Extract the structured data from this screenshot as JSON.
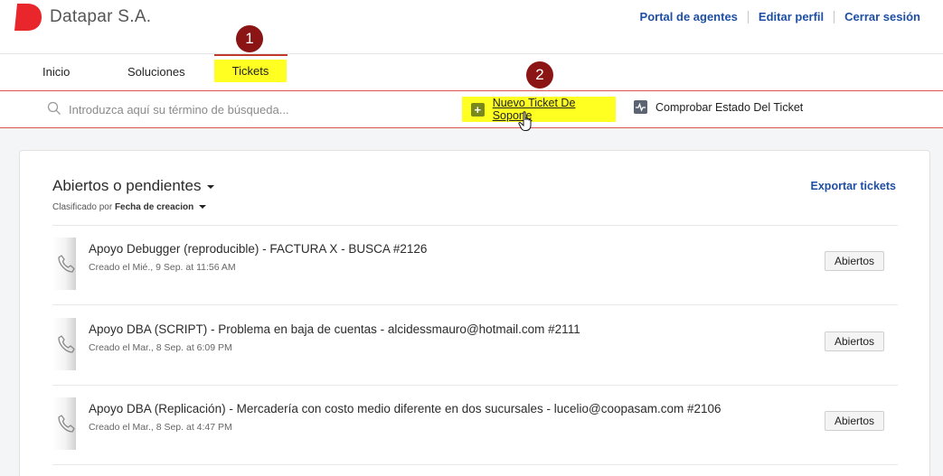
{
  "header": {
    "brand": "Datapar S.A.",
    "links": [
      "Portal de agentes",
      "Editar perfil",
      "Cerrar sesión"
    ],
    "accent_color": "#e8262b"
  },
  "nav": {
    "items": [
      "Inicio",
      "Soluciones",
      "Tickets"
    ],
    "active": "Tickets"
  },
  "annotations": [
    "1",
    "2"
  ],
  "search": {
    "placeholder": "Introduzca aquí su término de búsqueda..."
  },
  "actions": {
    "new_ticket": "Nuevo Ticket De Soporte",
    "check_status": "Comprobar Estado Del Ticket"
  },
  "tickets_view": {
    "title": "Abiertos o pendientes",
    "sort_prefix": "Clasificado por",
    "sort_field": "Fecha de creacion",
    "export": "Exportar tickets",
    "tickets": [
      {
        "title": "Apoyo Debugger (reproducible) - FACTURA X - BUSCA #2126",
        "date": "Creado el Mié., 9 Sep. at 11:56 AM",
        "status": "Abiertos"
      },
      {
        "title": "Apoyo DBA (SCRIPT) - Problema en baja de cuentas - alcidessmauro@hotmail.com #2111",
        "date": "Creado el Mar., 8 Sep. at 6:09 PM",
        "status": "Abiertos"
      },
      {
        "title": "Apoyo DBA (Replicación) - Mercadería con costo medio diferente en dos sucursales - lucelio@coopasam.com #2106",
        "date": "Creado el Mar., 8 Sep. at 4:47 PM",
        "status": "Abiertos"
      }
    ]
  }
}
